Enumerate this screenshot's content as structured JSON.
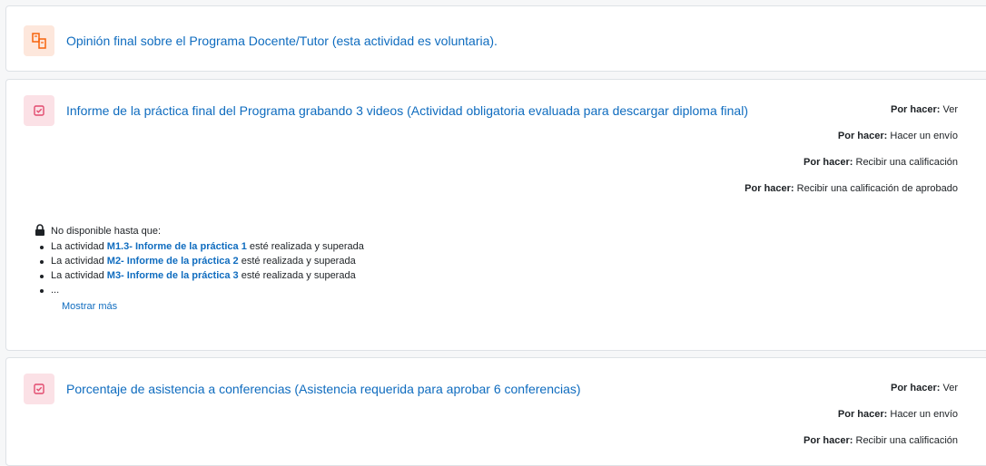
{
  "activities": [
    {
      "title": "Opinión final sobre el Programa Docente/Tutor (esta actividad es voluntaria).",
      "icon": "feedback-icon",
      "icon_color": "#f7630c"
    },
    {
      "title": "Informe de la práctica final del Programa grabando 3 videos (Actividad obligatoria evaluada para descargar diploma final)",
      "icon": "assignment-icon",
      "icon_color": "#e24a6e",
      "completion": [
        {
          "prefix": "Por hacer:",
          "text": "Ver"
        },
        {
          "prefix": "Por hacer:",
          "text": "Hacer un envío"
        },
        {
          "prefix": "Por hacer:",
          "text": "Recibir una calificación"
        },
        {
          "prefix": "Por hacer:",
          "text": "Recibir una calificación de aprobado"
        }
      ],
      "restriction": {
        "header": "No disponible hasta que:",
        "items": [
          {
            "before": "La actividad",
            "link": "M1.3- Informe de la práctica 1",
            "after": "esté realizada y superada"
          },
          {
            "before": "La actividad",
            "link": "M2- Informe de la práctica 2",
            "after": "esté realizada y superada"
          },
          {
            "before": "La actividad",
            "link": "M3- Informe de la práctica 3",
            "after": "esté realizada y superada"
          }
        ],
        "ellipsis": "...",
        "show_more": "Mostrar más"
      }
    },
    {
      "title": "Porcentaje de asistencia a conferencias (Asistencia requerida para aprobar 6 conferencias)",
      "icon": "assignment-icon",
      "icon_color": "#e24a6e",
      "completion": [
        {
          "prefix": "Por hacer:",
          "text": "Ver"
        },
        {
          "prefix": "Por hacer:",
          "text": "Hacer un envío"
        },
        {
          "prefix": "Por hacer:",
          "text": "Recibir una calificación"
        }
      ]
    }
  ]
}
